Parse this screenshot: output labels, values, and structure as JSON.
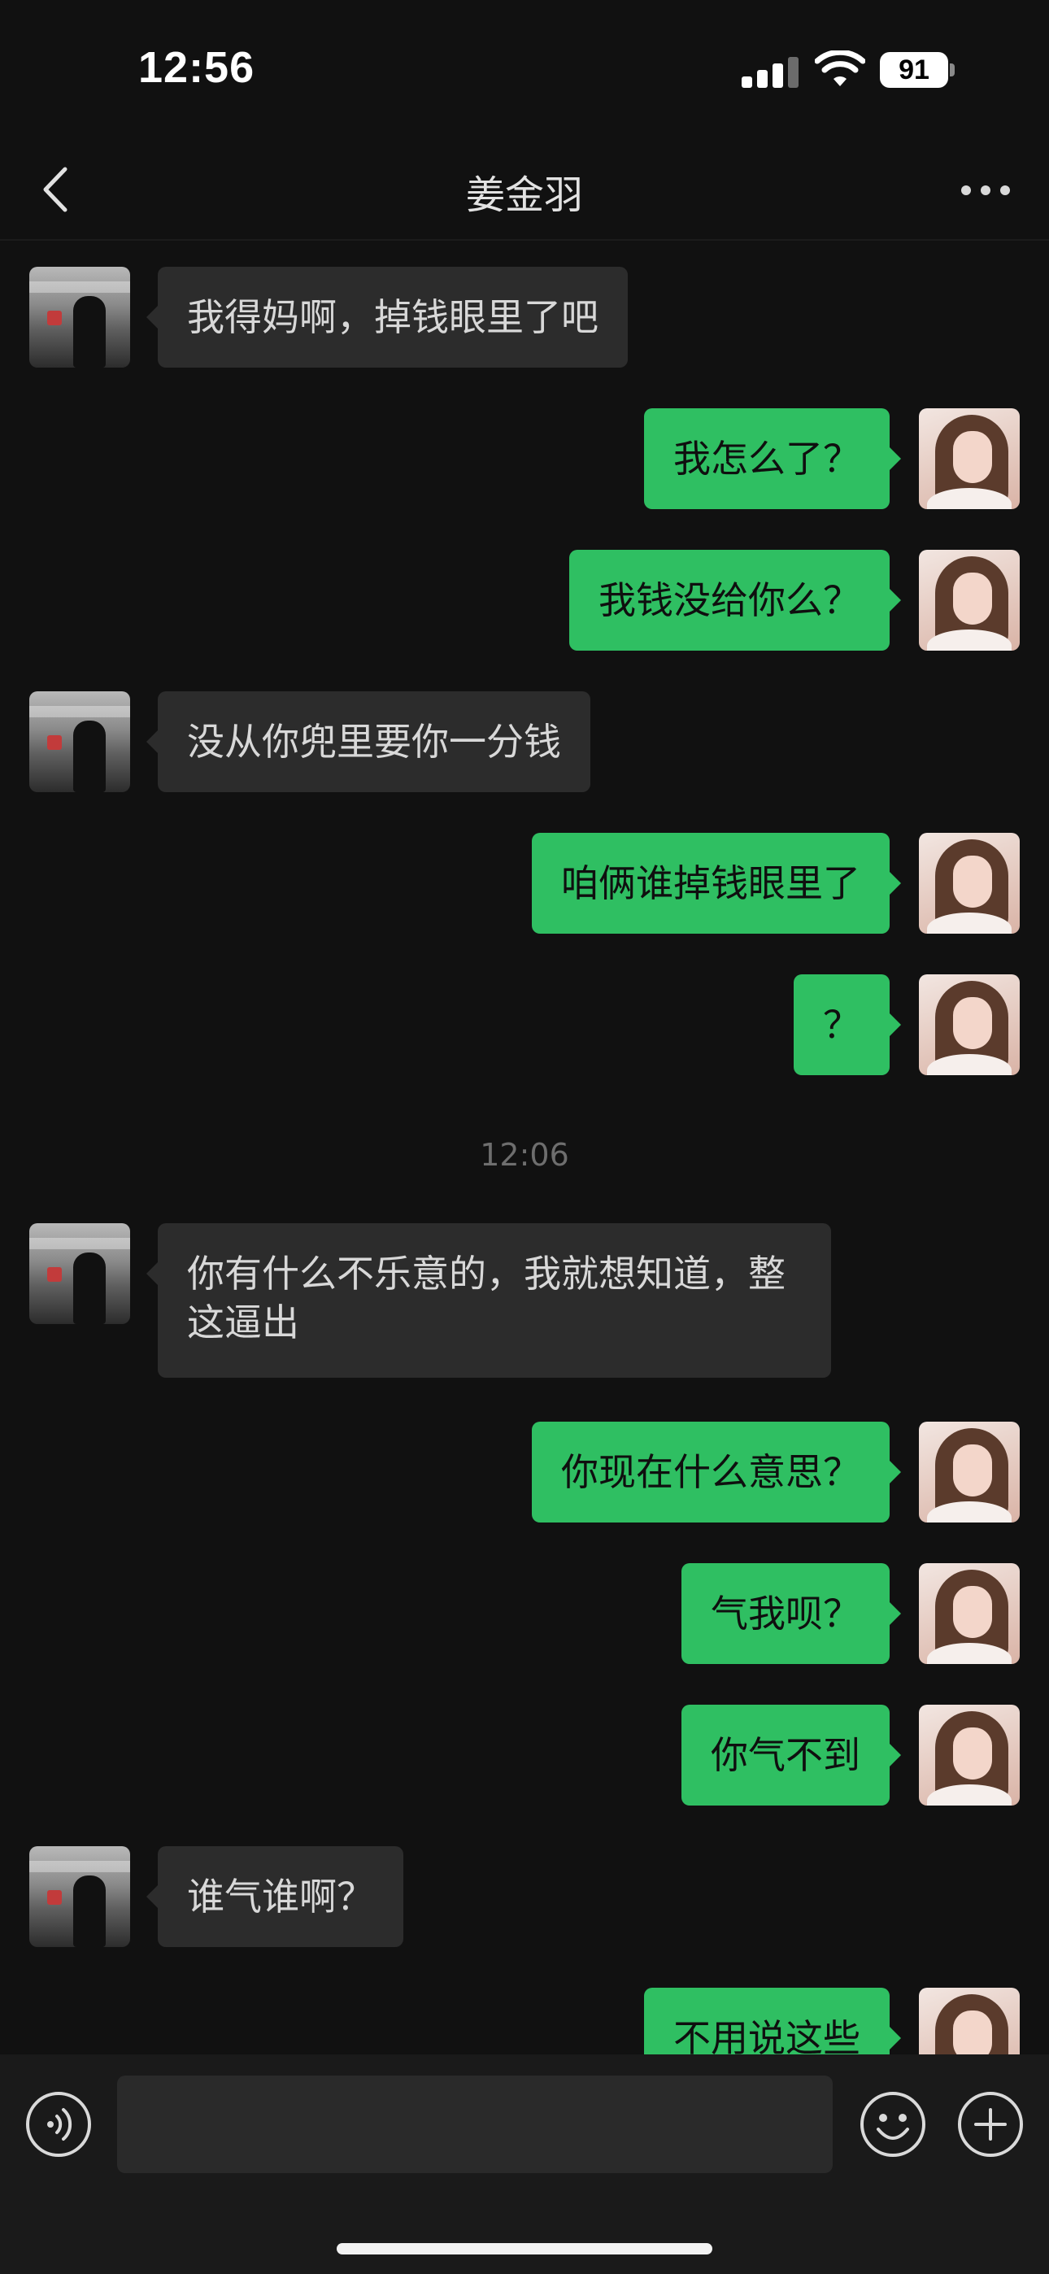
{
  "status": {
    "time": "12:56",
    "battery": "91"
  },
  "header": {
    "title": "姜金羽"
  },
  "messages": [
    {
      "side": "left",
      "text": "我得妈啊，掉钱眼里了吧"
    },
    {
      "side": "right",
      "text": "我怎么了？"
    },
    {
      "side": "right",
      "text": "我钱没给你么？"
    },
    {
      "side": "left",
      "text": "没从你兜里要你一分钱"
    },
    {
      "side": "right",
      "text": "咱俩谁掉钱眼里了"
    },
    {
      "side": "right",
      "text": "？"
    },
    {
      "side": "left",
      "text": "你有什么不乐意的，我就想知道，整这逼出"
    },
    {
      "side": "right",
      "text": "你现在什么意思？"
    },
    {
      "side": "right",
      "text": "气我呗？"
    },
    {
      "side": "right",
      "text": "你气不到"
    },
    {
      "side": "left",
      "text": "谁气谁啊？"
    },
    {
      "side": "right",
      "text": "不用说这些"
    }
  ],
  "divider_time": "12:06",
  "input": {
    "placeholder": ""
  },
  "icons": {
    "back": "chevron-left-icon",
    "more": "more-dots-icon",
    "voice": "voice-icon",
    "emoji": "emoji-icon",
    "plus": "plus-icon"
  },
  "colors": {
    "sent_bubble": "#2fbf62",
    "received_bubble": "#2c2c2c",
    "background": "#111111"
  }
}
